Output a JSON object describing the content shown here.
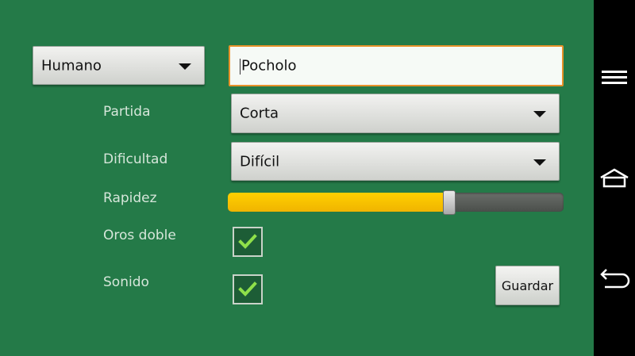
{
  "player": {
    "type_selected": "Humano",
    "name_value": "Pocholo"
  },
  "settings": {
    "partida": {
      "label": "Partida",
      "selected": "Corta"
    },
    "dificultad": {
      "label": "Dificultad",
      "selected": "Difícil"
    },
    "rapidez": {
      "label": "Rapidez",
      "level_fraction": 0.66
    },
    "oros_doble": {
      "label": "Oros doble",
      "checked": true
    },
    "sonido": {
      "label": "Sonido",
      "checked": true
    }
  },
  "actions": {
    "save_label": "Guardar"
  },
  "navbar": {
    "icons": [
      "menu-icon",
      "home-icon",
      "back-icon"
    ]
  },
  "colors": {
    "background": "#247a48",
    "accent_orange": "#e8922a",
    "slider_fill": "#f0b400",
    "checkbox_tick": "#8fe04a"
  }
}
